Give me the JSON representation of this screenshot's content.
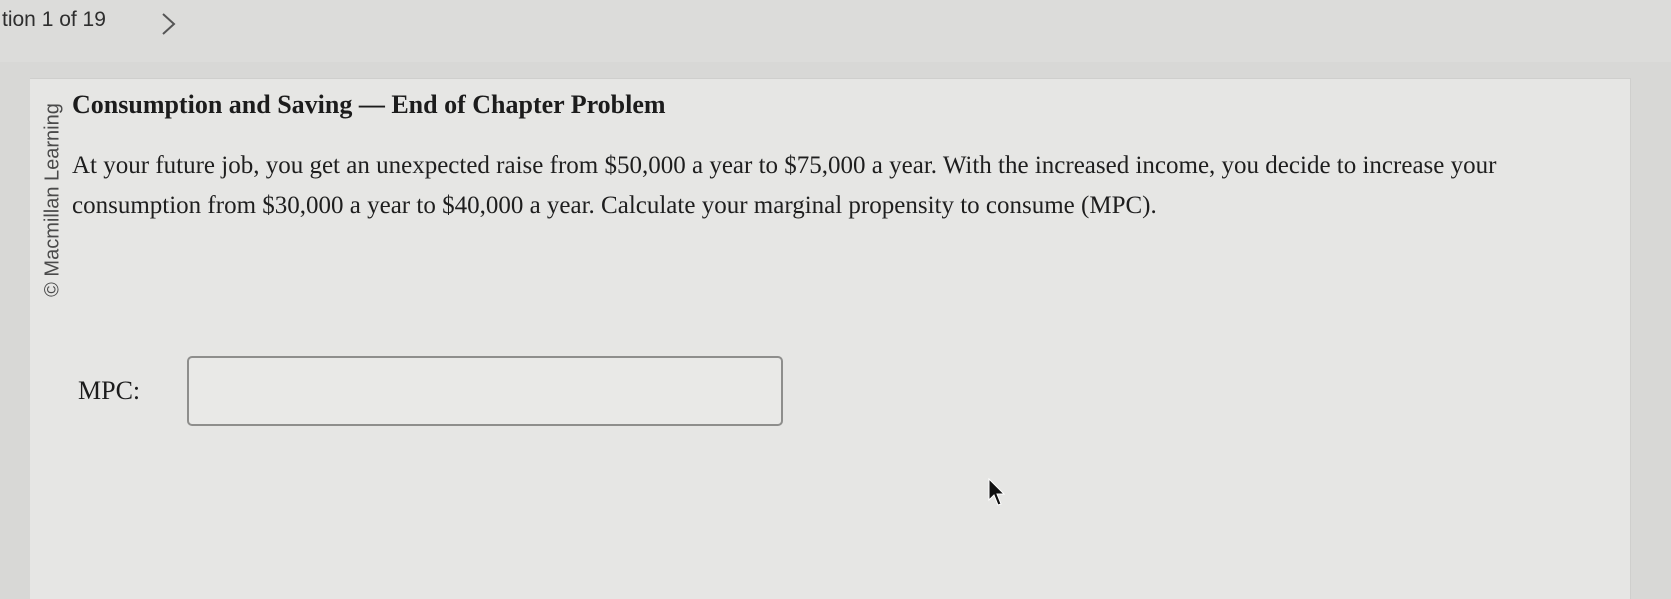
{
  "nav": {
    "question_counter": "tion 1 of 19",
    "next_icon": "chevron-right-icon"
  },
  "sidebar": {
    "copyright": "© Macmillan Learning"
  },
  "question": {
    "title": "Consumption and Saving — End of Chapter Problem",
    "body": "At your future job, you get an unexpected raise from $50,000 a year to $75,000 a year. With the increased income, you decide to increase your consumption from $30,000 a year to $40,000 a year. Calculate your marginal propensity to consume (MPC).",
    "answer_label": "MPC:",
    "answer_value": ""
  },
  "cursor_icon": "mouse-pointer-icon",
  "colors": {
    "background": "#d8d8d6",
    "card": "#e6e6e4",
    "text": "#1c1c1c",
    "input_border": "#8e8e8c"
  }
}
